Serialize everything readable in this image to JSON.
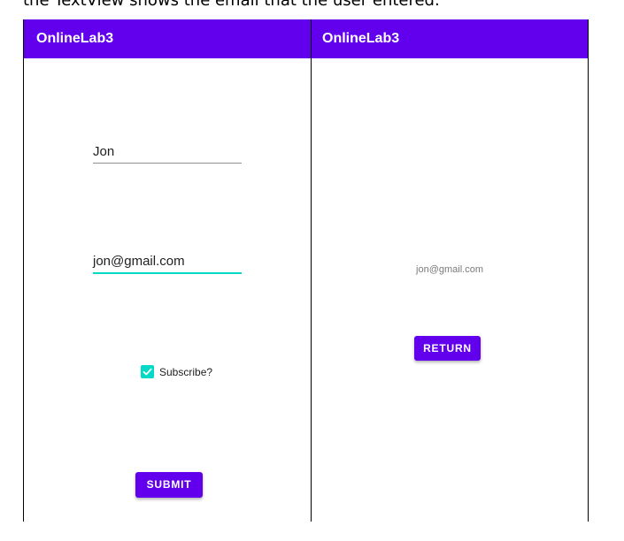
{
  "caption": "the TextView shows the email that the user entered.",
  "screen1": {
    "app_title": "OnlineLab3",
    "name_value": "Jon",
    "email_value": "jon@gmail.com",
    "checkbox_label": "Subscribe?",
    "checkbox_checked": true,
    "submit_label": "SUBMIT"
  },
  "screen2": {
    "app_title": "OnlineLab3",
    "email_text": "jon@gmail.com",
    "return_label": "RETURN"
  },
  "colors": {
    "primary": "#6200ee",
    "accent": "#03dac5"
  }
}
